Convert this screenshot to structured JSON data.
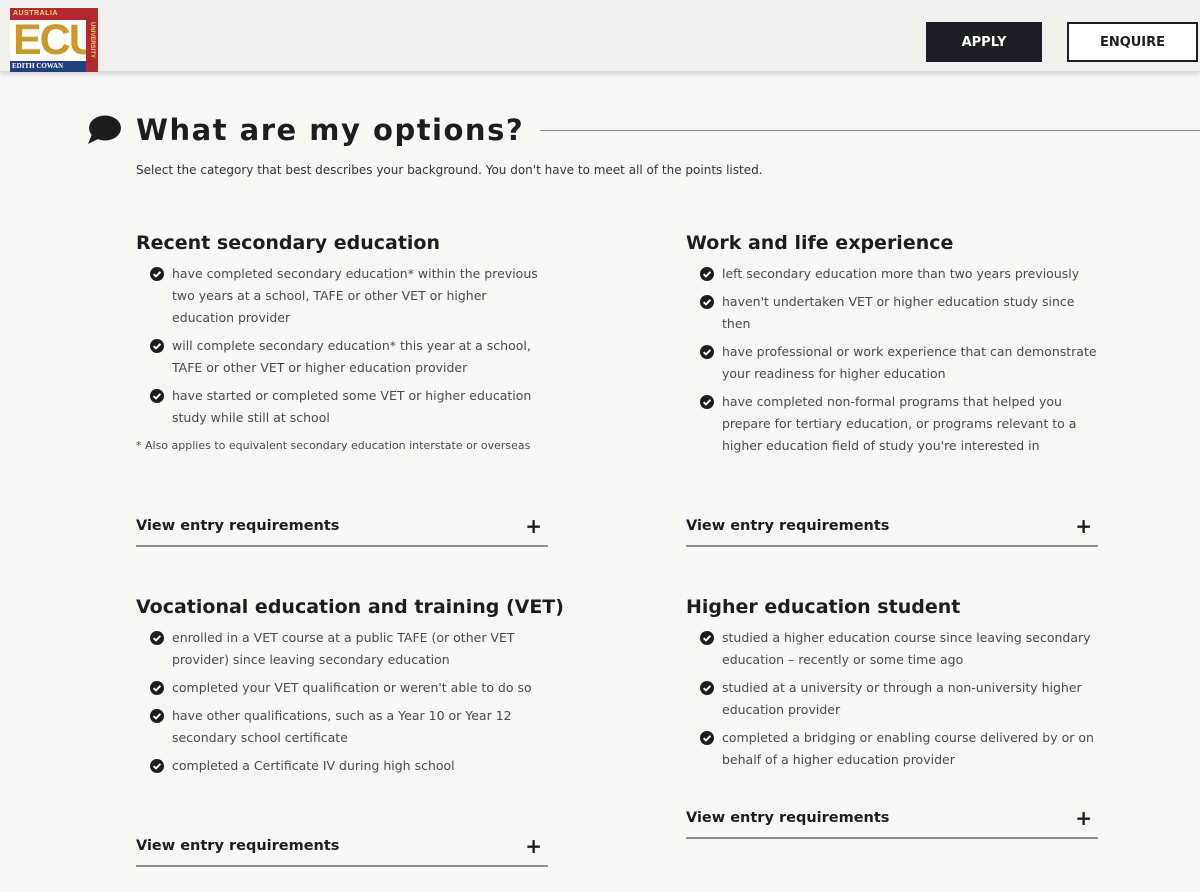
{
  "header": {
    "logo": {
      "top_text": "AUSTRALIA",
      "letters": "ECU",
      "bottom_text": "EDITH COWAN",
      "side_text": "UNIVERSITY"
    },
    "apply_label": "APPLY",
    "enquire_label": "ENQUIRE"
  },
  "section": {
    "title": "What are my options?",
    "subtitle": "Select the category that best describes your background. You don't have to meet all of the points listed."
  },
  "cards": [
    {
      "title": "Recent secondary education",
      "points": [
        "have completed secondary education* within the previous two years at a school, TAFE or other VET or higher education provider",
        "will complete secondary education* this year at a school, TAFE or other VET or higher education provider",
        "have started or completed some VET or higher education study while still at school"
      ],
      "footnote": "* Also applies to equivalent secondary education interstate or overseas",
      "entry_label": "View entry requirements"
    },
    {
      "title": "Work and life experience",
      "points": [
        "left secondary education more than two years previously",
        "haven't undertaken VET or higher education study since then",
        "have professional or work experience that can demonstrate your readiness for higher education",
        "have completed non-formal programs that helped you prepare for tertiary education, or programs relevant to a higher education field of study you're interested in"
      ],
      "footnote": "",
      "entry_label": "View entry requirements"
    },
    {
      "title": "Vocational education and training (VET)",
      "points": [
        "enrolled in a VET course at a public TAFE (or other VET provider) since leaving secondary education",
        "completed your VET qualification or weren't able to do so",
        "have other qualifications, such as a Year 10 or Year 12 secondary school certificate",
        "completed a Certificate IV during high school"
      ],
      "footnote": "",
      "entry_label": "View entry requirements"
    },
    {
      "title": "Higher education student",
      "points": [
        "studied a higher education course since leaving secondary education – recently or some time ago",
        "studied at a university or through a non-university higher education provider",
        "completed a bridging or enabling course delivered by or on behalf of a higher education provider"
      ],
      "footnote": "",
      "entry_label": "View entry requirements"
    }
  ],
  "icons": {
    "heading": "speech-bubble-icon",
    "bullet": "check-circle-icon",
    "expand": "plus-icon"
  },
  "colors": {
    "header_bg": "#f1f1ef",
    "apply_bg": "#1c1f24",
    "ecu_blue": "#23407e",
    "ecu_red": "#b22a2e",
    "ecu_gold": "#c89a2e"
  }
}
